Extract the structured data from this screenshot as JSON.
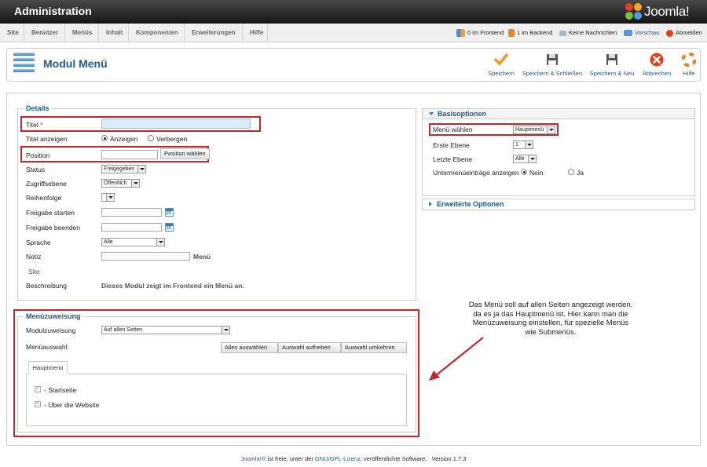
{
  "header": {
    "title": "Administration",
    "logo_text": "Joomla!"
  },
  "menu": {
    "items": [
      "Site",
      "Benutzer",
      "Menüs",
      "Inhalt",
      "Komponenten",
      "Erweiterungen",
      "Hilfe"
    ],
    "status": {
      "frontend": "0 im Frontend",
      "backend": "1 im Backend",
      "messages": "Keine Nachrichten",
      "preview": "Vorschau",
      "logout": "Abmelden"
    }
  },
  "toolbar": {
    "page_title": "Modul Menü",
    "buttons": {
      "save": "Speichern",
      "save_close": "Speichern & Schließen",
      "save_new": "Speichern & Neu",
      "cancel": "Abbrechen",
      "help": "Hilfe"
    }
  },
  "details": {
    "legend": "Details",
    "title_label": "Titel",
    "required_mark": "*",
    "title_value": "",
    "show_title_label": "Titel anzeigen",
    "show_title_yes": "Anzeigen",
    "show_title_no": "Verbergen",
    "position_label": "Position",
    "position_value": "",
    "position_button": "Position wählen",
    "status_label": "Status",
    "status_value": "Freigegeben",
    "access_label": "Zugriffsebene",
    "access_value": "Öffentlich",
    "order_label": "Reihenfolge",
    "order_value": "",
    "publish_up_label": "Freigabe starten",
    "publish_down_label": "Freigabe beenden",
    "calendar_icon_text": "23",
    "language_label": "Sprache",
    "language_value": "Alle",
    "note_label": "Notiz",
    "note_value": "",
    "module_type": "Menü",
    "site_label": "Site",
    "description_label": "Beschreibung",
    "description_value": "Dieses Modul zeigt im Frontend ein Menü an."
  },
  "assignment": {
    "legend": "Menüzuweisung",
    "module_assignment_label": "Modulzuweisung",
    "module_assignment_value": "Auf allen Seiten",
    "menu_selection_label": "Menüauswahl:",
    "select_all": "Alles auswählen",
    "clear_selection": "Auswahl aufheben",
    "invert_selection": "Auswahl umkehren",
    "tab_label": "Hauptmenü",
    "items": [
      "- Startseite",
      "- Über die Website"
    ]
  },
  "basic_options": {
    "title": "Basisoptionen",
    "menu_select_label": "Menü wählen",
    "menu_select_value": "Hauptmenü",
    "start_level_label": "Erste Ebene",
    "start_level_value": "1",
    "end_level_label": "Letzte Ebene",
    "end_level_value": "Alle",
    "show_submenu_label": "Untermenüeinträge anzeigen",
    "submenu_no": "Nein",
    "submenu_yes": "Ja"
  },
  "advanced_options": {
    "title": "Erweiterte Optionen"
  },
  "annotation": {
    "text": "Das Menü soll auf allen Seiten angezeigt werden, da es ja das Hauptmenü ist. Hier kann man die Menüzuweisung einstellen, für spezielle Menüs wie Submenüs."
  },
  "footer": {
    "joomla_link": "Joomla!®",
    "text_part1": " ist freie, unter der ",
    "license_link": "GNU/GPL-Lizenz",
    "text_part2": ", veröffentlichte Software.",
    "version": "Version 1.7.3"
  },
  "colors": {
    "accent": "#1f5a92",
    "highlight_border": "#c1272d",
    "title_field_bg": "#d9ecfb",
    "topbar": "#1e1e1e"
  }
}
